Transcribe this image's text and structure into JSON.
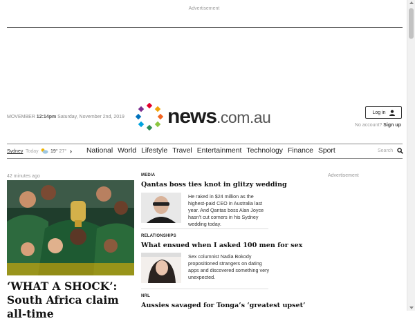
{
  "ad": {
    "top_label": "Advertisement",
    "right_label": "Advertisement"
  },
  "masthead": {
    "date_time": "12:14pm",
    "date_prefix": "MOVEMBER",
    "date_text": "Saturday, November 2nd, 2019",
    "logo_main": "news",
    "logo_suffix": ".com.au",
    "login_label": "Log in",
    "no_account": "No account?",
    "sign_up": "Sign up"
  },
  "nav": {
    "location": "Sydney",
    "today": "Today",
    "temp_low": "19°",
    "temp_high": "27°",
    "items": [
      "National",
      "World",
      "Lifestyle",
      "Travel",
      "Entertainment",
      "Technology",
      "Finance",
      "Sport"
    ],
    "search_label": "Search"
  },
  "hero": {
    "time_ago": "42 minutes ago",
    "title": "‘WHAT A SHOCK’: South Africa claim all-time"
  },
  "stories": [
    {
      "section": "MEDIA",
      "headline": "Qantas boss ties knot in glitzy wedding",
      "summary": "He raked in $24 million as the highest-paid CEO in Australia last year. And Qantas boss Alan Joyce hasn’t cut corners in his Sydney wedding today."
    },
    {
      "section": "RELATIONSHIPS",
      "headline": "What ensued when I asked 100 men for sex",
      "summary": "Sex columnist Nadia Bokody propositioned strangers on dating apps and discovered something very unexpected."
    },
    {
      "section": "NRL",
      "headline": "Aussies savaged for Tonga’s ‘greatest upset’"
    }
  ],
  "colors": {
    "accent": "#222222",
    "logo_dots": [
      "#e4002b",
      "#f0a30a",
      "#8cc63f",
      "#00a3e0",
      "#7b2d8e",
      "#f26522",
      "#2e8b57",
      "#0072bc"
    ]
  },
  "icons": {
    "user": "user-icon",
    "search": "search-icon",
    "weather": "cloud-sun-icon",
    "chevron": "chevron-right-icon"
  }
}
